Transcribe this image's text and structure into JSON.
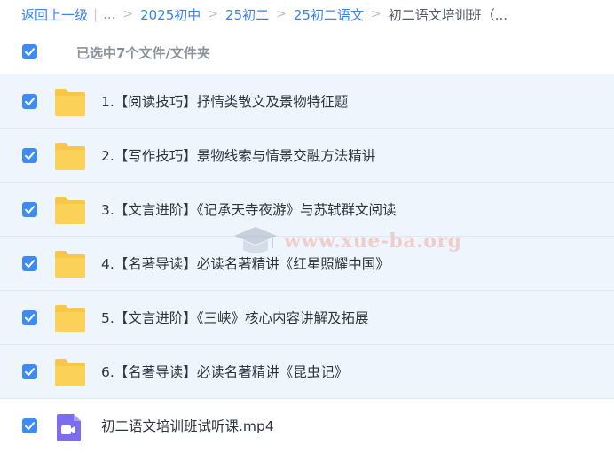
{
  "breadcrumb": {
    "back": "返回上一级",
    "ellipsis": "...",
    "items": [
      "2025初中",
      "25初二",
      "25初二语文"
    ],
    "current": "初二语文培训班（..."
  },
  "selection": {
    "label": "已选中7个文件/文件夹",
    "checked": true
  },
  "files": [
    {
      "name": "1.【阅读技巧】抒情类散文及景物特征题",
      "type": "folder",
      "checked": true
    },
    {
      "name": "2.【写作技巧】景物线索与情景交融方法精讲",
      "type": "folder",
      "checked": true
    },
    {
      "name": "3.【文言进阶】《记承天寺夜游》与苏轼群文阅读",
      "type": "folder",
      "checked": true
    },
    {
      "name": "4.【名著导读】必读名著精讲《红星照耀中国》",
      "type": "folder",
      "checked": true
    },
    {
      "name": "5.【文言进阶】《三峡》核心内容讲解及拓展",
      "type": "folder",
      "checked": true
    },
    {
      "name": "6.【名著导读】必读名著精讲《昆虫记》",
      "type": "folder",
      "checked": true
    },
    {
      "name": "初二语文培训班试听课.mp4",
      "type": "video",
      "checked": true
    }
  ],
  "watermark": {
    "text": "www.xue-ba.org"
  },
  "colors": {
    "accent": "#3d8bf8",
    "folder": "#f9c748",
    "video": "#7b6cf0",
    "row_bg": "#eef5fd"
  }
}
